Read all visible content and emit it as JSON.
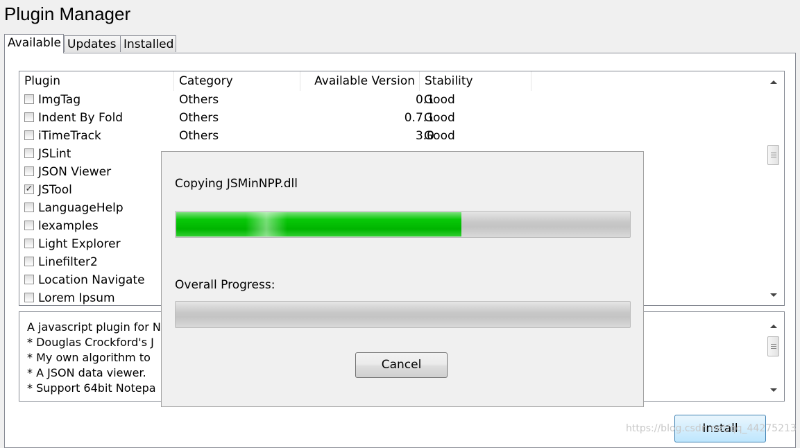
{
  "window": {
    "title": "Plugin Manager"
  },
  "tabs": [
    {
      "label": "Available",
      "active": true
    },
    {
      "label": "Updates",
      "active": false
    },
    {
      "label": "Installed",
      "active": false
    }
  ],
  "plugin_list": {
    "columns": [
      "Plugin",
      "Category",
      "Available Version",
      "Stability"
    ],
    "rows": [
      {
        "name": "ImgTag",
        "category": "Others",
        "version": "0.1",
        "stability": "Good",
        "checked": false
      },
      {
        "name": "Indent By Fold",
        "category": "Others",
        "version": "0.7.1",
        "stability": "Good",
        "checked": false
      },
      {
        "name": "iTimeTrack",
        "category": "Others",
        "version": "3.0",
        "stability": "Good",
        "checked": false
      },
      {
        "name": "JSLint",
        "category": "",
        "version": "",
        "stability": "",
        "checked": false
      },
      {
        "name": "JSON Viewer",
        "category": "",
        "version": "",
        "stability": "",
        "checked": false
      },
      {
        "name": "JSTool",
        "category": "",
        "version": "",
        "stability": "",
        "checked": true
      },
      {
        "name": "LanguageHelp",
        "category": "",
        "version": "",
        "stability": "",
        "checked": false
      },
      {
        "name": "lexamples",
        "category": "",
        "version": "",
        "stability": "",
        "checked": false
      },
      {
        "name": "Light Explorer",
        "category": "",
        "version": "",
        "stability": "",
        "checked": false
      },
      {
        "name": "Linefilter2",
        "category": "",
        "version": "",
        "stability": "",
        "checked": false
      },
      {
        "name": "Location Navigate",
        "category": "",
        "version": "",
        "stability": "",
        "checked": false
      },
      {
        "name": "Lorem Ipsum",
        "category": "",
        "version": "",
        "stability": "",
        "checked": false
      }
    ]
  },
  "description": {
    "lines": [
      "A javascript plugin for N",
      " * Douglas Crockford's J",
      " * My own algorithm to",
      " * A JSON data viewer.",
      " * Support 64bit Notepa"
    ]
  },
  "buttons": {
    "install": "Install"
  },
  "watermark": "https://blog.csdn.net/qq_44275213",
  "progress_dialog": {
    "file_label": "Copying JSMinNPP.dll",
    "file_progress": 0.63,
    "overall_label": "Overall Progress:",
    "overall_progress": 0,
    "cancel_label": "Cancel"
  },
  "colors": {
    "progress_fill": "#00c000",
    "accent": "#3c7fb1"
  }
}
